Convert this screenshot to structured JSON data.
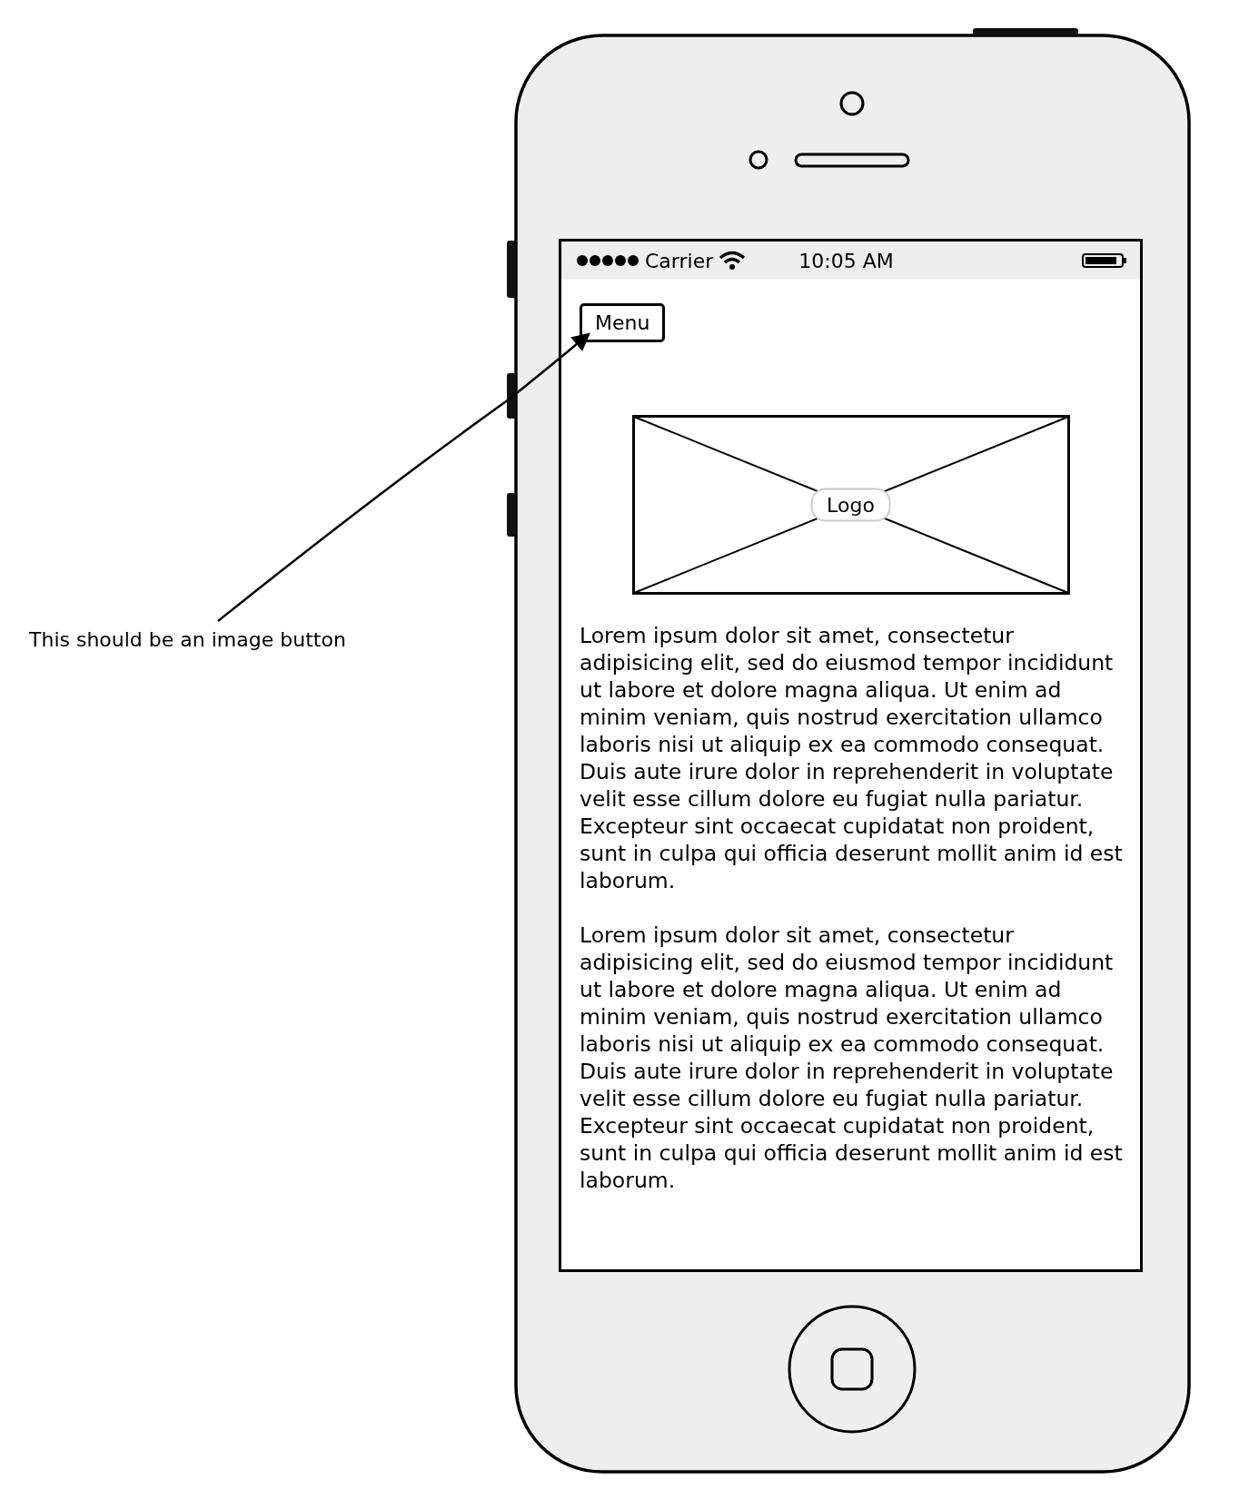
{
  "annotation": {
    "text": "This should be an image button"
  },
  "status_bar": {
    "carrier": "Carrier",
    "time": "10:05 AM"
  },
  "menu_button": {
    "label": "Menu"
  },
  "logo": {
    "label": "Logo"
  },
  "paragraphs": [
    "Lorem ipsum dolor sit amet, consectetur adipisicing elit, sed do eiusmod tempor incididunt ut labore et dolore magna aliqua. Ut enim ad minim veniam, quis nostrud exercitation ullamco laboris nisi ut aliquip ex ea commodo consequat. Duis aute irure dolor in reprehenderit in voluptate velit esse cillum dolore eu fugiat nulla pariatur. Excepteur sint occaecat cupidatat non proident, sunt in culpa qui officia deserunt mollit anim id est laborum.",
    "Lorem ipsum dolor sit amet, consectetur adipisicing elit, sed do eiusmod tempor incididunt ut labore et dolore magna aliqua. Ut enim ad minim veniam, quis nostrud exercitation ullamco laboris nisi ut aliquip ex ea commodo consequat. Duis aute irure dolor in reprehenderit in voluptate velit esse cillum dolore eu fugiat nulla pariatur. Excepteur sint occaecat cupidatat non proident, sunt in culpa qui officia deserunt mollit anim id est laborum."
  ]
}
